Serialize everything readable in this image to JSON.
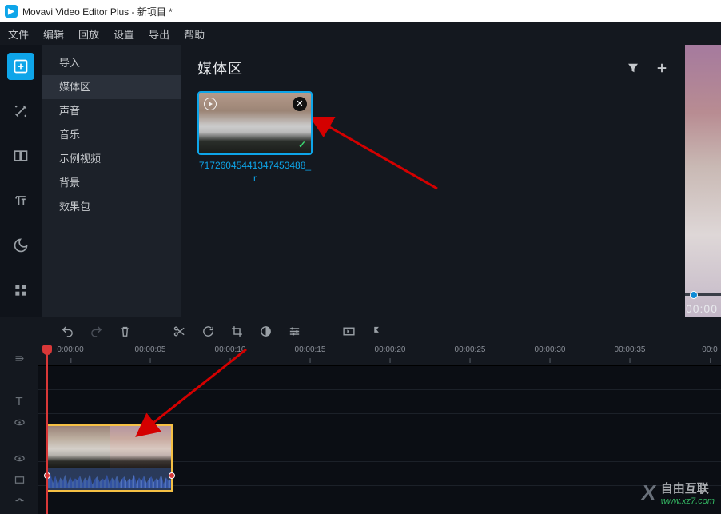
{
  "titlebar": {
    "text": "Movavi Video Editor Plus - 新项目 *"
  },
  "menubar": {
    "items": [
      "文件",
      "编辑",
      "回放",
      "设置",
      "导出",
      "帮助"
    ]
  },
  "rail": {
    "icons": [
      "import-icon",
      "magic-icon",
      "transition-icon",
      "text-icon",
      "sticker-icon",
      "more-icon"
    ],
    "active": 0
  },
  "sidelist": {
    "items": [
      "导入",
      "媒体区",
      "声音",
      "音乐",
      "示例视频",
      "背景",
      "效果包"
    ],
    "active": 1
  },
  "content": {
    "title": "媒体区",
    "clip_label": "71726045441347453488_r",
    "check_glyph": "✓"
  },
  "preview": {
    "time": "00:00"
  },
  "timeline": {
    "ticks": [
      "0:00:00",
      "00:00:05",
      "00:00:10",
      "00:00:15",
      "00:00:20",
      "00:00:25",
      "00:00:30",
      "00:00:35"
    ],
    "partial_tick": "00:0"
  },
  "watermark": {
    "cn": "自由互联",
    "url": "www.xz7.com"
  }
}
